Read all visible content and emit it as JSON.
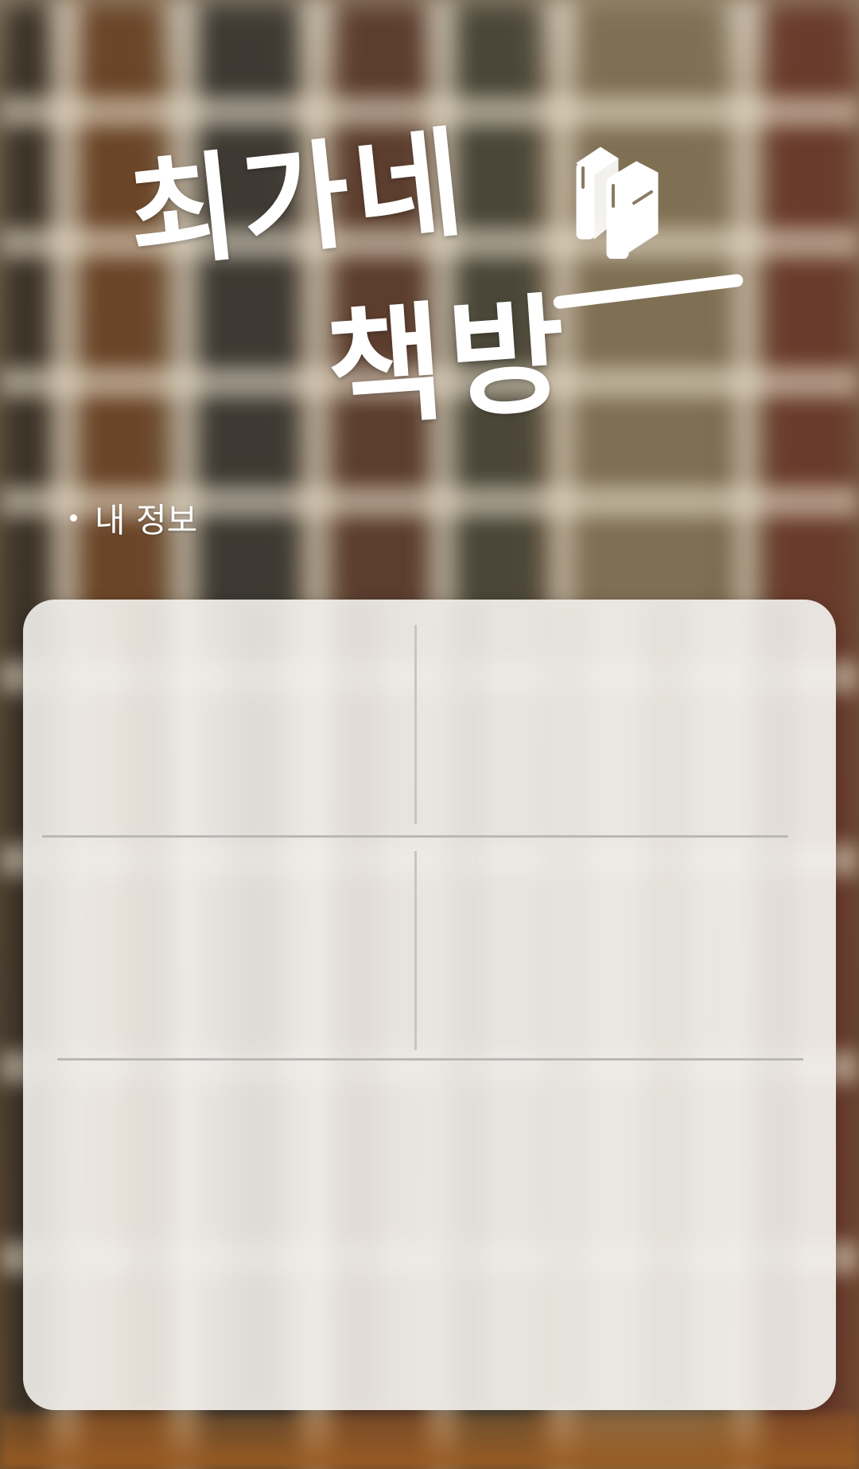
{
  "app": {
    "title_line1": "최가네",
    "title_line2": "책방"
  },
  "section": {
    "label": "내 정보"
  },
  "icons": {
    "title_icon": "books-icon"
  },
  "colors": {
    "title": "#ffffff",
    "card_bg": "#f2f0ec",
    "divider": "#c7c5c2"
  }
}
